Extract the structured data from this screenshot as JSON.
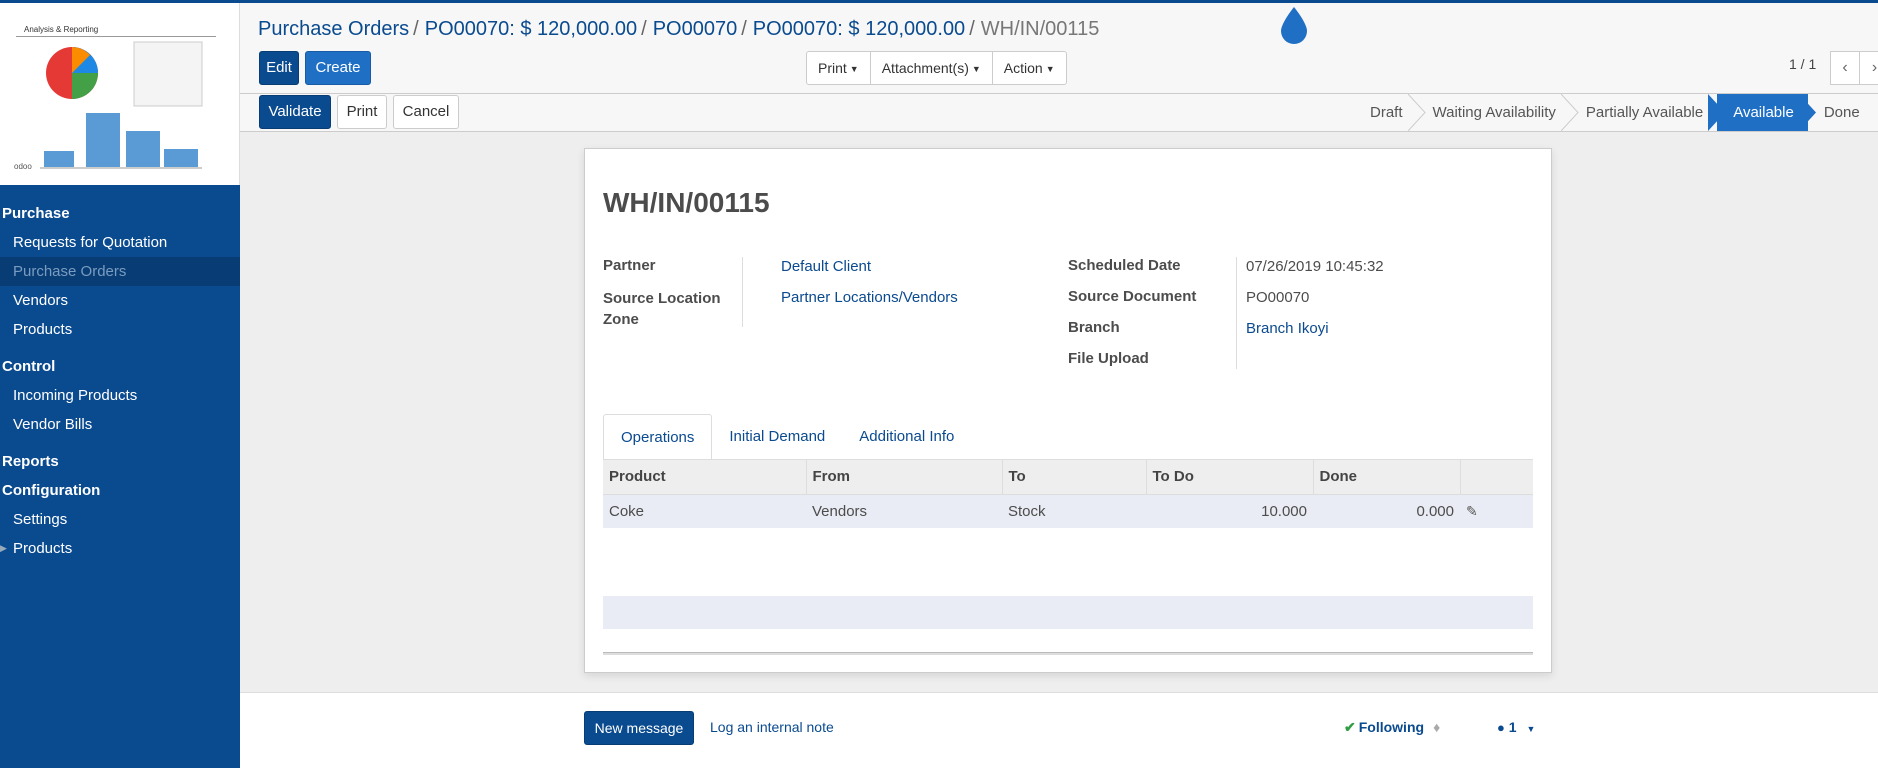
{
  "sidebar": {
    "logo_title": "Analysis & Reporting",
    "logo_brand": "odoo",
    "sections": [
      {
        "title": "Purchase",
        "items": [
          "Requests for Quotation",
          "Purchase Orders",
          "Vendors",
          "Products"
        ]
      },
      {
        "title": "Control",
        "items": [
          "Incoming Products",
          "Vendor Bills"
        ]
      },
      {
        "title": "Reports",
        "items": []
      },
      {
        "title": "Configuration",
        "items": [
          "Settings",
          "Products"
        ]
      }
    ],
    "active_item": "Purchase Orders"
  },
  "breadcrumb": {
    "items": [
      "Purchase Orders",
      "PO00070: $ 120,000.00",
      "PO00070",
      "PO00070: $ 120,000.00"
    ],
    "current": "WH/IN/00115"
  },
  "toolbar": {
    "edit": "Edit",
    "create": "Create",
    "print": "Print",
    "attachments": "Attachment(s)",
    "action": "Action",
    "pager": "1 / 1"
  },
  "statusbar": {
    "validate": "Validate",
    "print": "Print",
    "cancel": "Cancel",
    "stages": [
      "Draft",
      "Waiting Availability",
      "Partially Available",
      "Available",
      "Done"
    ],
    "active_stage": "Available"
  },
  "record": {
    "title": "WH/IN/00115",
    "partner_label": "Partner",
    "partner": "Default Client",
    "source_location_label": "Source Location Zone",
    "source_location": "Partner Locations/Vendors",
    "scheduled_date_label": "Scheduled Date",
    "scheduled_date": "07/26/2019 10:45:32",
    "source_document_label": "Source Document",
    "source_document": "PO00070",
    "branch_label": "Branch",
    "branch": "Branch Ikoyi",
    "file_upload_label": "File Upload"
  },
  "tabs": [
    "Operations",
    "Initial Demand",
    "Additional Info"
  ],
  "operations": {
    "columns": [
      "Product",
      "From",
      "To",
      "To Do",
      "Done"
    ],
    "rows": [
      {
        "product": "Coke",
        "from": "Vendors",
        "to": "Stock",
        "todo": "10.000",
        "done": "0.000"
      }
    ]
  },
  "chatter": {
    "new_message": "New message",
    "log_note": "Log an internal note",
    "following": "Following",
    "followers": "1"
  },
  "colors": {
    "primary": "#0a4a8f",
    "accent": "#1f6fc5",
    "follow_check": "#2f9e44"
  }
}
